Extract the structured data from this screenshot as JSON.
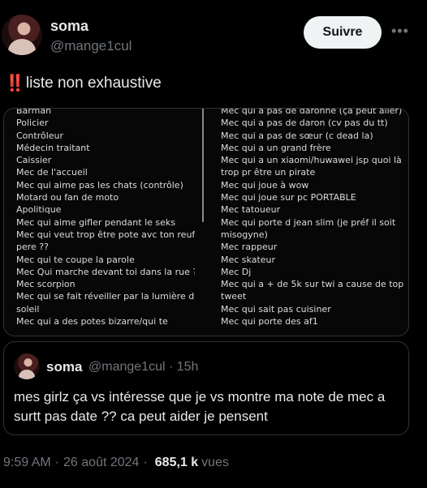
{
  "author": {
    "name": "soma",
    "handle": "@mange1cul"
  },
  "follow_label": "Suivre",
  "more_icon": "more-horizontal-icon",
  "tweet": {
    "emoji": "‼️",
    "text": "liste non exhaustive"
  },
  "note_image": {
    "left": [
      "Barman",
      "Policier",
      "Contrôleur",
      "Médecin traitant",
      "Caissier",
      "Mec de l'accueil",
      "Mec qui aime pas les chats (contrôle)",
      "Motard ou fan de moto",
      "Apolitique",
      "Mec qui aime gifler pendant le seks",
      "Mec qui veut trop être pote avc ton reuf/",
      "pere ??",
      "Mec qui te coupe la parole",
      "Mec Qui marche devant toi dans la rue ??",
      "Mec scorpion",
      "Mec qui se fait réveiller par la lumière du",
      "soleil",
      "Mec qui a des potes bizarre/qui te"
    ],
    "right": [
      "Mec qui a pas de daronne (ça peut aller)",
      "Mec qui a pas de daron (cv pas du tt)",
      "Mec qui a pas de sœur (c dead la)",
      "Mec qui a un grand frère",
      "Mec qui a un xiaomi/huwawei jsp quoi là c",
      "trop pr être un pirate",
      "Mec qui joue à wow",
      "Mec qui joue sur pc PORTABLE",
      "Mec tatoueur",
      "Mec qui porte d jean slim (je préf il soit",
      "misogyne)",
      "Mec rappeur",
      "Mec skateur",
      "Mec Dj",
      "Mec qui a + de 5k sur twi a cause de top",
      "tweet",
      "Mec qui sait pas cuisiner",
      "Mec qui porte des af1"
    ]
  },
  "quoted": {
    "name": "soma",
    "handle": "@mange1cul",
    "time": "15h",
    "text": "mes girlz ça vs intéresse que je vs montre ma note de mec a surtt pas date ?? ca peut aider je pensent"
  },
  "footer": {
    "time": "9:59 AM",
    "date": "26 août 2024",
    "views": "685,1 k",
    "views_label": "vues"
  }
}
